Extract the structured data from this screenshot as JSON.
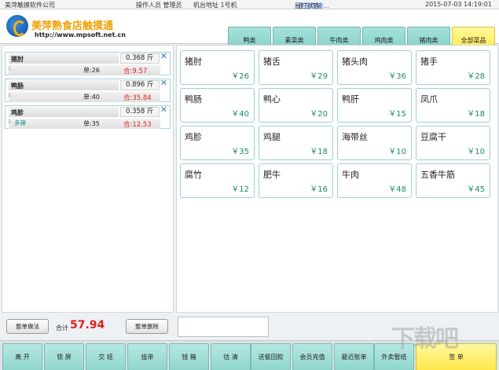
{
  "topbar": {
    "company": "美萍触摸软件公司",
    "operator": "操作人员 管理员",
    "machine": "机台地址  1号机",
    "print_label": "厨打状态",
    "print_status": "正在连接...",
    "datetime": "2015-07-03 14:19:01"
  },
  "header": {
    "brand_title": "美萍熟食店触摸通",
    "brand_url": "http://www.mpsoft.net.cn"
  },
  "categories": [
    {
      "label": "鸭类"
    },
    {
      "label": "素菜类"
    },
    {
      "label": "牛肉类"
    },
    {
      "label": "鸡肉类"
    },
    {
      "label": "猪肉类"
    },
    {
      "label": "全部菜品"
    }
  ],
  "order_items": [
    {
      "name": "猪肘",
      "qty": "0.368",
      "unit": "斤",
      "index": "1.",
      "note": "",
      "price": "单:26",
      "total": "合:9.57"
    },
    {
      "name": "鸭肠",
      "qty": "0.896",
      "unit": "斤",
      "index": "2.",
      "note": "",
      "price": "单:40",
      "total": "合:35.84"
    },
    {
      "name": "鸡胗",
      "qty": "0.358",
      "unit": "斤",
      "index": "3.",
      "note": "多辣",
      "price": "单:35",
      "total": "合:12.53"
    }
  ],
  "footer": {
    "note_button": "整单做法",
    "sum_label": "合计",
    "sum_value": "57.94",
    "clear_button": "整单删除"
  },
  "dishes": [
    {
      "name": "猪肘",
      "price": "￥26"
    },
    {
      "name": "猪舌",
      "price": "￥29"
    },
    {
      "name": "猪头肉",
      "price": "￥36"
    },
    {
      "name": "猪手",
      "price": "￥28"
    },
    {
      "name": "鸭肠",
      "price": "￥40"
    },
    {
      "name": "鸭心",
      "price": "￥20"
    },
    {
      "name": "鸭肝",
      "price": "￥15"
    },
    {
      "name": "凤爪",
      "price": "￥18"
    },
    {
      "name": "鸡胗",
      "price": "￥35"
    },
    {
      "name": "鸡腿",
      "price": "￥18"
    },
    {
      "name": "海带丝",
      "price": "￥10"
    },
    {
      "name": "豆腐干",
      "price": "￥10"
    },
    {
      "name": "腐竹",
      "price": "￥12"
    },
    {
      "name": "肥牛",
      "price": "￥16"
    },
    {
      "name": "牛肉",
      "price": "￥48"
    },
    {
      "name": "五香牛筋",
      "price": "￥45"
    }
  ],
  "bottom_buttons": [
    {
      "label": "离 开"
    },
    {
      "label": "锁 屏"
    },
    {
      "label": "交 班"
    },
    {
      "label": "挂单"
    },
    {
      "label": "钱 箱"
    },
    {
      "label": "估 清"
    },
    {
      "label": "送餐回款"
    },
    {
      "label": "会员充值"
    },
    {
      "label": "最近账单"
    },
    {
      "label": "外卖暂结"
    },
    {
      "label": "签 单"
    }
  ],
  "watermark": "下载吧"
}
